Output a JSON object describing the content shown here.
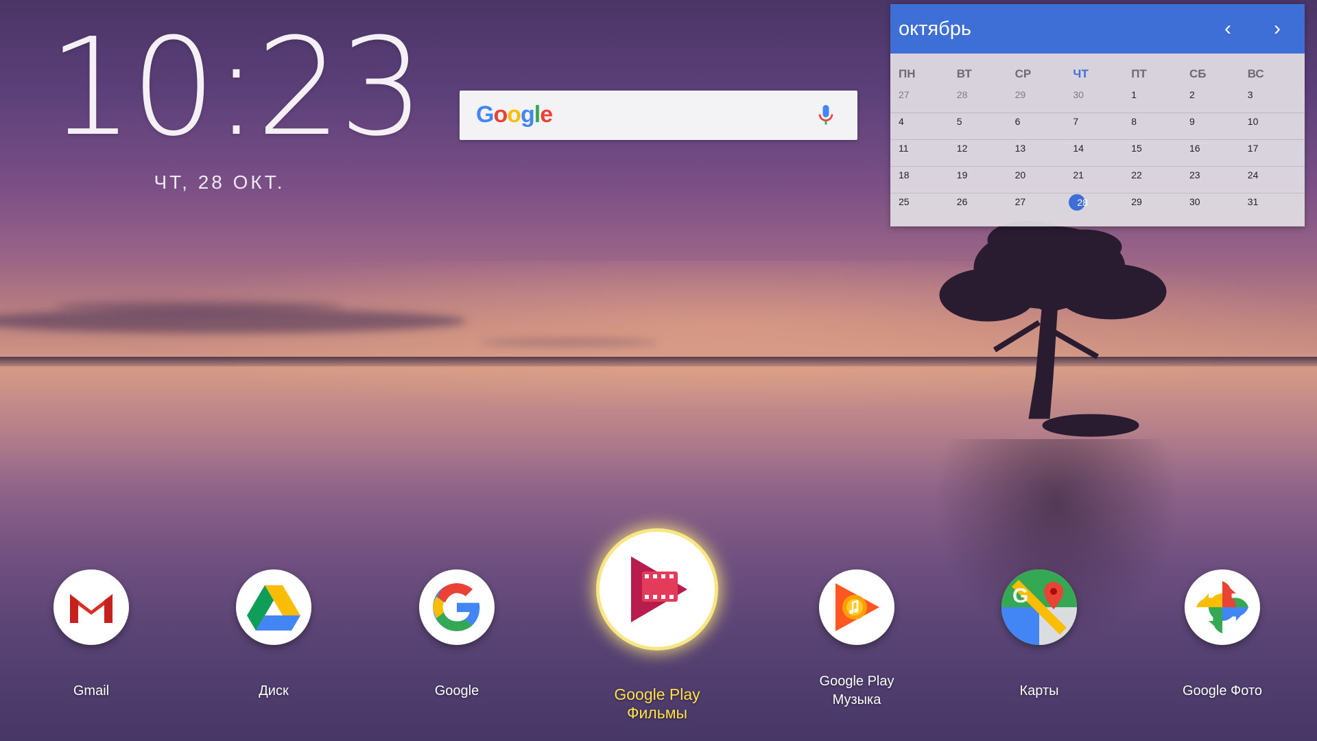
{
  "clock": {
    "time": "10:23",
    "date": "ЧТ, 28 ОКТ."
  },
  "search": {
    "logo_letters": [
      "G",
      "o",
      "o",
      "g",
      "l",
      "e"
    ],
    "logo_colors": [
      "#4285F4",
      "#EA4335",
      "#FBBC05",
      "#4285F4",
      "#34A853",
      "#EA4335"
    ],
    "mic_icon": "mic-icon"
  },
  "calendar": {
    "month": "октябрь",
    "prev_icon": "chevron-left-icon",
    "next_icon": "chevron-right-icon",
    "weekdays": [
      "ПН",
      "ВТ",
      "СР",
      "ЧТ",
      "ПТ",
      "СБ",
      "ВС"
    ],
    "today_weekday_index": 3,
    "weeks": [
      [
        "27",
        "28",
        "29",
        "30",
        "1",
        "2",
        "3"
      ],
      [
        "4",
        "5",
        "6",
        "7",
        "8",
        "9",
        "10"
      ],
      [
        "11",
        "12",
        "13",
        "14",
        "15",
        "16",
        "17"
      ],
      [
        "18",
        "19",
        "20",
        "21",
        "22",
        "23",
        "24"
      ],
      [
        "25",
        "26",
        "27",
        "28",
        "29",
        "30",
        "31"
      ]
    ],
    "today": "28",
    "accent_color": "#3d6fd6"
  },
  "apps": [
    {
      "label": "Gmail",
      "icon": "gmail-icon"
    },
    {
      "label": "Диск",
      "icon": "drive-icon"
    },
    {
      "label": "Google",
      "icon": "google-icon"
    },
    {
      "label": "Google Play Фильмы",
      "icon": "play-movies-icon",
      "focused": true
    },
    {
      "label": "Google Play Музыка",
      "icon": "play-music-icon"
    },
    {
      "label": "Карты",
      "icon": "maps-icon"
    },
    {
      "label": "Google Фото",
      "icon": "photos-icon"
    }
  ],
  "colors": {
    "focus_glow": "#ffe14a"
  }
}
